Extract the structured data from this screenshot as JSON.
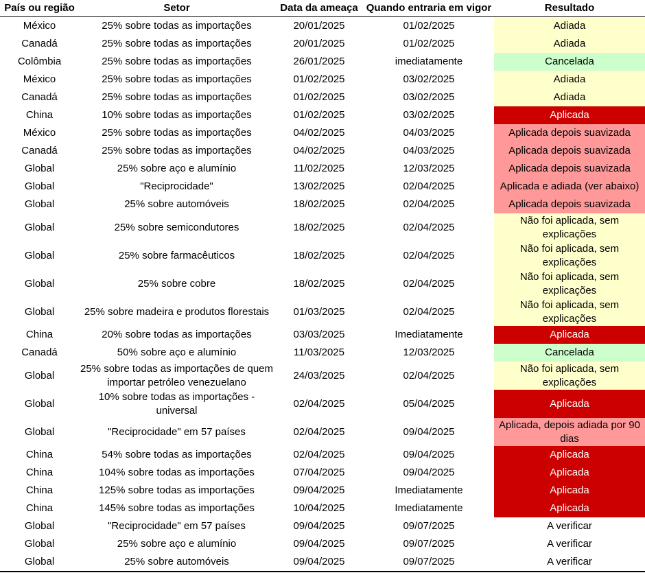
{
  "headers": [
    "País ou região",
    "Setor",
    "Data da ameaça",
    "Quando entraria em vigor",
    "Resultado"
  ],
  "colors": {
    "adiada": "#ffffcc",
    "cancelada": "#ccffcc",
    "aplicada": "#cc0000",
    "suavizada": "#ff9999",
    "nao": "#ffffcc",
    "verificar": "#ffffff"
  },
  "rows": [
    {
      "pais": "México",
      "setor": "25% sobre todas as importações",
      "data": "20/01/2025",
      "vigor": "01/02/2025",
      "resultado": "Adiada",
      "status": "adiada"
    },
    {
      "pais": "Canadá",
      "setor": "25% sobre todas as importações",
      "data": "20/01/2025",
      "vigor": "01/02/2025",
      "resultado": "Adiada",
      "status": "adiada"
    },
    {
      "pais": "Colômbia",
      "setor": "25% sobre todas as importações",
      "data": "26/01/2025",
      "vigor": "imediatamente",
      "resultado": "Cancelada",
      "status": "cancelada"
    },
    {
      "pais": "México",
      "setor": "25% sobre todas as importações",
      "data": "01/02/2025",
      "vigor": "03/02/2025",
      "resultado": "Adiada",
      "status": "adiada"
    },
    {
      "pais": "Canadá",
      "setor": "25% sobre todas as importações",
      "data": "01/02/2025",
      "vigor": "03/02/2025",
      "resultado": "Adiada",
      "status": "adiada"
    },
    {
      "pais": "China",
      "setor": "10% sobre todas as importações",
      "data": "01/02/2025",
      "vigor": "03/02/2025",
      "resultado": "Aplicada",
      "status": "aplicada"
    },
    {
      "pais": "México",
      "setor": "25% sobre todas as importações",
      "data": "04/02/2025",
      "vigor": "04/03/2025",
      "resultado": "Aplicada depois suavizada",
      "status": "suavizada"
    },
    {
      "pais": "Canadá",
      "setor": "25% sobre todas as importações",
      "data": "04/02/2025",
      "vigor": "04/03/2025",
      "resultado": "Aplicada depois suavizada",
      "status": "suavizada"
    },
    {
      "pais": "Global",
      "setor": "25% sobre aço e alumínio",
      "data": "11/02/2025",
      "vigor": "12/03/2025",
      "resultado": "Aplicada depois suavizada",
      "status": "suavizada"
    },
    {
      "pais": "Global",
      "setor": "\"Reciprocidade\"",
      "data": "13/02/2025",
      "vigor": "02/04/2025",
      "resultado": "Aplicada e adiada (ver abaixo)",
      "status": "suavizada"
    },
    {
      "pais": "Global",
      "setor": "25% sobre automóveis",
      "data": "18/02/2025",
      "vigor": "02/04/2025",
      "resultado": "Aplicada depois suavizada",
      "status": "suavizada"
    },
    {
      "pais": "Global",
      "setor": "25% sobre semicondutores",
      "data": "18/02/2025",
      "vigor": "02/04/2025",
      "resultado": "Não foi aplicada, sem explicações",
      "status": "nao",
      "tall": true
    },
    {
      "pais": "Global",
      "setor": "25% sobre farmacêuticos",
      "data": "18/02/2025",
      "vigor": "02/04/2025",
      "resultado": "Não foi aplicada, sem explicações",
      "status": "nao",
      "tall": true
    },
    {
      "pais": "Global",
      "setor": "25% sobre cobre",
      "data": "18/02/2025",
      "vigor": "02/04/2025",
      "resultado": "Não foi aplicada, sem explicações",
      "status": "nao",
      "tall": true
    },
    {
      "pais": "Global",
      "setor": "25% sobre madeira e produtos florestais",
      "data": "01/03/2025",
      "vigor": "02/04/2025",
      "resultado": "Não foi aplicada, sem explicações",
      "status": "nao",
      "tall": true
    },
    {
      "pais": "China",
      "setor": "20% sobre todas as importações",
      "data": "03/03/2025",
      "vigor": "Imediatamente",
      "resultado": "Aplicada",
      "status": "aplicada"
    },
    {
      "pais": "Canadá",
      "setor": "50% sobre aço e alumínio",
      "data": "11/03/2025",
      "vigor": "12/03/2025",
      "resultado": "Cancelada",
      "status": "cancelada"
    },
    {
      "pais": "Global",
      "setor": "25% sobre todas as importações de quem importar petróleo venezuelano",
      "data": "24/03/2025",
      "vigor": "02/04/2025",
      "resultado": "Não foi aplicada, sem explicações",
      "status": "nao",
      "tall": true
    },
    {
      "pais": "Global",
      "setor": "10% sobre todas as importações - universal",
      "data": "02/04/2025",
      "vigor": "05/04/2025",
      "resultado": "Aplicada",
      "status": "aplicada",
      "tall": true
    },
    {
      "pais": "Global",
      "setor": "\"Reciprocidade\" em 57 países",
      "data": "02/04/2025",
      "vigor": "09/04/2025",
      "resultado": "Aplicada, depois adiada por 90 dias",
      "status": "suavizada",
      "tall": true
    },
    {
      "pais": "China",
      "setor": "54% sobre todas as importações",
      "data": "02/04/2025",
      "vigor": "09/04/2025",
      "resultado": "Aplicada",
      "status": "aplicada"
    },
    {
      "pais": "China",
      "setor": "104% sobre todas as importações",
      "data": "07/04/2025",
      "vigor": "09/04/2025",
      "resultado": "Aplicada",
      "status": "aplicada"
    },
    {
      "pais": "China",
      "setor": "125% sobre todas as importações",
      "data": "09/04/2025",
      "vigor": "Imediatamente",
      "resultado": "Aplicada",
      "status": "aplicada"
    },
    {
      "pais": "China",
      "setor": "145% sobre todas as importações",
      "data": "10/04/2025",
      "vigor": "Imediatamente",
      "resultado": "Aplicada",
      "status": "aplicada"
    },
    {
      "pais": "Global",
      "setor": "\"Reciprocidade\" em 57 países",
      "data": "09/04/2025",
      "vigor": "09/07/2025",
      "resultado": "A verificar",
      "status": "verificar"
    },
    {
      "pais": "Global",
      "setor": "25% sobre aço e alumínio",
      "data": "09/04/2025",
      "vigor": "09/07/2025",
      "resultado": "A verificar",
      "status": "verificar"
    },
    {
      "pais": "Global",
      "setor": "25% sobre automóveis",
      "data": "09/04/2025",
      "vigor": "09/07/2025",
      "resultado": "A verificar",
      "status": "verificar"
    }
  ]
}
